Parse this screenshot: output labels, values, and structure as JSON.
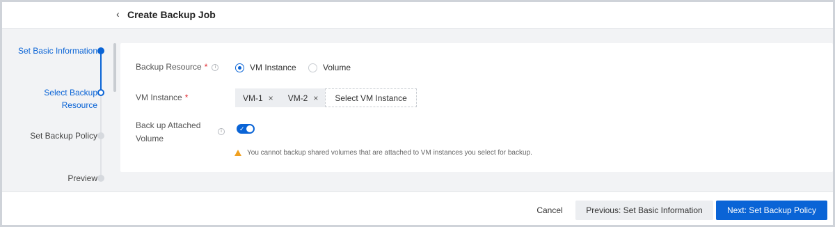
{
  "header": {
    "back_glyph": "‹",
    "title": "Create Backup Job"
  },
  "steps": [
    {
      "label": "Set Basic Information",
      "state": "done"
    },
    {
      "label": "Select Backup Resource",
      "state": "current"
    },
    {
      "label": "Set Backup Policy",
      "state": "todo"
    },
    {
      "label": "Preview",
      "state": "todo"
    }
  ],
  "form": {
    "backup_resource": {
      "label": "Backup Resource",
      "required": "*",
      "options": [
        "VM Instance",
        "Volume"
      ],
      "selected": "VM Instance"
    },
    "vm_instance": {
      "label": "VM Instance",
      "required": "*",
      "tags": [
        "VM-1",
        "VM-2"
      ],
      "remove_glyph": "×",
      "select_button": "Select VM Instance"
    },
    "attached_volume": {
      "label_line1": "Back up Attached",
      "label_line2": "Volume",
      "toggle_on": true,
      "warning": "You cannot backup shared volumes that are attached to VM instances you select for backup."
    }
  },
  "footer": {
    "cancel": "Cancel",
    "previous": "Previous: Set Basic Information",
    "next": "Next: Set Backup Policy"
  },
  "colors": {
    "accent": "#0a64d6",
    "required": "#e0262d",
    "warning": "#f0a020"
  },
  "icons": {
    "info": "info-circle-icon",
    "warning": "warning-triangle-icon",
    "back": "chevron-left-icon"
  }
}
